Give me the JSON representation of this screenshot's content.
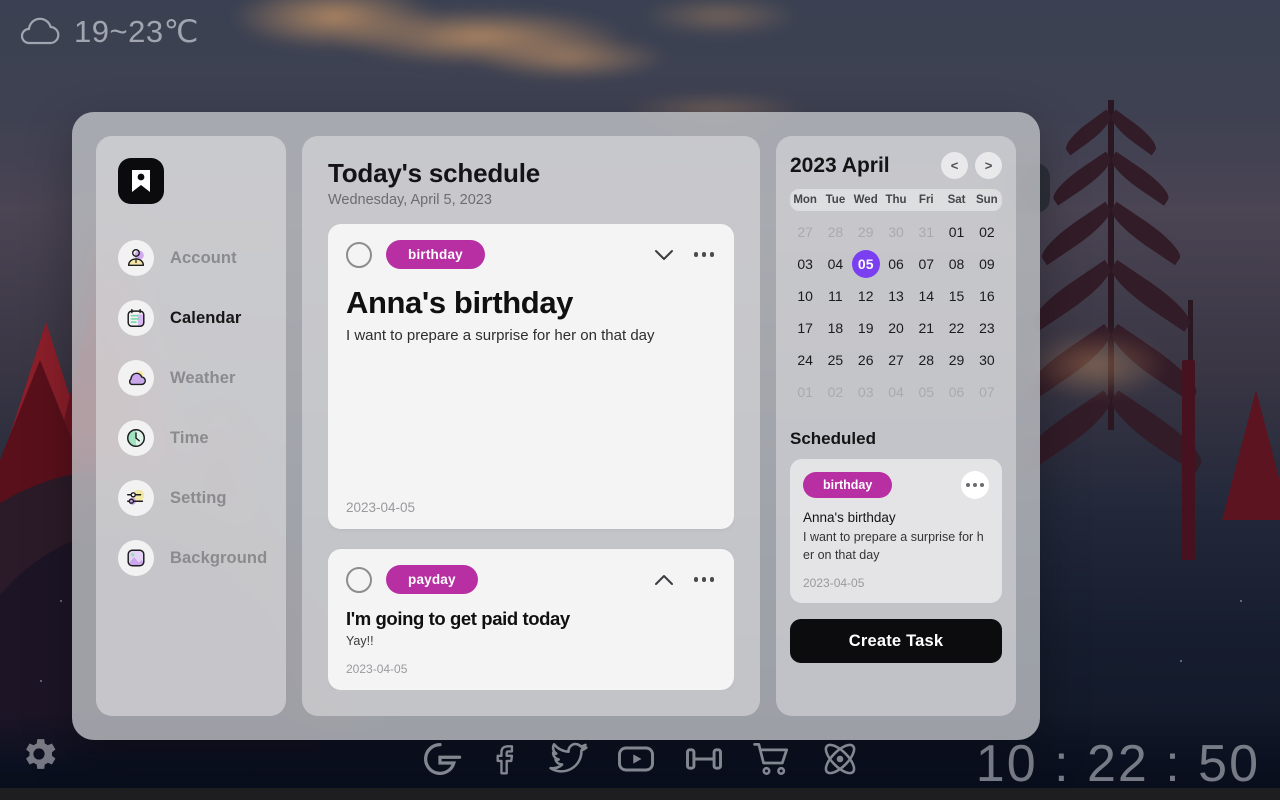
{
  "desktop": {
    "weather": {
      "icon": "cloud-icon",
      "temperature": "19~23℃"
    },
    "clock": "10 : 22 : 50",
    "settings_icon": "gear-icon",
    "dock": [
      {
        "name": "google-icon",
        "label": "G"
      },
      {
        "name": "facebook-icon",
        "label": "f"
      },
      {
        "name": "twitter-icon",
        "label": "twitter"
      },
      {
        "name": "youtube-icon",
        "label": "youtube"
      },
      {
        "name": "dumbbell-icon",
        "label": "fitness"
      },
      {
        "name": "shopping-cart-icon",
        "label": "cart"
      },
      {
        "name": "atom-icon",
        "label": "react"
      }
    ]
  },
  "app": {
    "logo": "bookmark-icon",
    "sidebar": {
      "items": [
        {
          "label": "Account",
          "icon": "user-icon",
          "active": false
        },
        {
          "label": "Calendar",
          "icon": "calendar-icon",
          "active": true
        },
        {
          "label": "Weather",
          "icon": "cloud-sun-icon",
          "active": false
        },
        {
          "label": "Time",
          "icon": "clock-icon",
          "active": false
        },
        {
          "label": "Setting",
          "icon": "sliders-icon",
          "active": false
        },
        {
          "label": "Background",
          "icon": "image-icon",
          "active": false
        }
      ]
    },
    "schedule": {
      "title": "Today's schedule",
      "subtitle": "Wednesday, April 5, 2023",
      "tasks": [
        {
          "tag": "birthday",
          "title": "Anna's birthday",
          "description": "I want to prepare a surprise for her on that day",
          "date": "2023-04-05",
          "expanded": true,
          "chevron": "chevron-down-icon"
        },
        {
          "tag": "payday",
          "title": "I'm going to get paid today",
          "description": "Yay!!",
          "date": "2023-04-05",
          "expanded": false,
          "chevron": "chevron-up-icon"
        }
      ]
    },
    "calendar": {
      "title": "2023 April",
      "prev_label": "<",
      "next_label": ">",
      "weekdays": [
        "Mon",
        "Tue",
        "Wed",
        "Thu",
        "Fri",
        "Sat",
        "Sun"
      ],
      "selected_day": "05",
      "accent_color": "#7b3ff2",
      "weeks": [
        [
          {
            "d": "27",
            "m": true
          },
          {
            "d": "28",
            "m": true
          },
          {
            "d": "29",
            "m": true
          },
          {
            "d": "30",
            "m": true
          },
          {
            "d": "31",
            "m": true
          },
          {
            "d": "01",
            "m": false
          },
          {
            "d": "02",
            "m": false
          }
        ],
        [
          {
            "d": "03",
            "m": false
          },
          {
            "d": "04",
            "m": false
          },
          {
            "d": "05",
            "m": false,
            "sel": true
          },
          {
            "d": "06",
            "m": false
          },
          {
            "d": "07",
            "m": false
          },
          {
            "d": "08",
            "m": false
          },
          {
            "d": "09",
            "m": false
          }
        ],
        [
          {
            "d": "10",
            "m": false
          },
          {
            "d": "11",
            "m": false
          },
          {
            "d": "12",
            "m": false
          },
          {
            "d": "13",
            "m": false
          },
          {
            "d": "14",
            "m": false
          },
          {
            "d": "15",
            "m": false
          },
          {
            "d": "16",
            "m": false
          }
        ],
        [
          {
            "d": "17",
            "m": false
          },
          {
            "d": "18",
            "m": false
          },
          {
            "d": "19",
            "m": false
          },
          {
            "d": "20",
            "m": false
          },
          {
            "d": "21",
            "m": false
          },
          {
            "d": "22",
            "m": false
          },
          {
            "d": "23",
            "m": false
          }
        ],
        [
          {
            "d": "24",
            "m": false
          },
          {
            "d": "25",
            "m": false
          },
          {
            "d": "26",
            "m": false
          },
          {
            "d": "27",
            "m": false
          },
          {
            "d": "28",
            "m": false
          },
          {
            "d": "29",
            "m": false
          },
          {
            "d": "30",
            "m": false
          }
        ],
        [
          {
            "d": "01",
            "m": true
          },
          {
            "d": "02",
            "m": true
          },
          {
            "d": "03",
            "m": true
          },
          {
            "d": "04",
            "m": true
          },
          {
            "d": "05",
            "m": true
          },
          {
            "d": "06",
            "m": true
          },
          {
            "d": "07",
            "m": true
          }
        ]
      ]
    },
    "scheduled": {
      "title": "Scheduled",
      "items": [
        {
          "tag": "birthday",
          "name": "Anna's birthday",
          "description": "I want to prepare a surprise for her on that day",
          "date": "2023-04-05"
        }
      ],
      "create_button": "Create Task"
    },
    "tag_color": "#b72fa2"
  }
}
